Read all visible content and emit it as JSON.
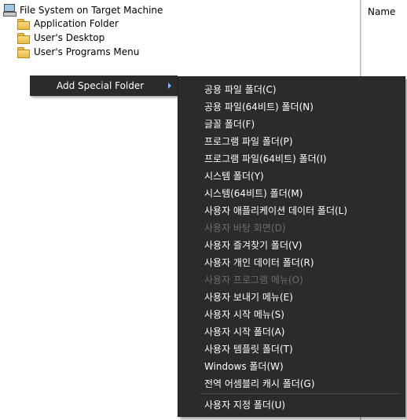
{
  "tree": {
    "root_label": "File System on Target Machine",
    "items": [
      {
        "label": "Application Folder"
      },
      {
        "label": "User's Desktop"
      },
      {
        "label": "User's Programs Menu"
      }
    ]
  },
  "list_header": {
    "name": "Name"
  },
  "submenu_parent": {
    "label": "Add Special Folder"
  },
  "menu": {
    "items": [
      {
        "label": "공용 파일 폴더(C)",
        "enabled": true
      },
      {
        "label": "공용 파일(64비트) 폴더(N)",
        "enabled": true
      },
      {
        "label": "글꼴 폴더(F)",
        "enabled": true
      },
      {
        "label": "프로그램 파일 폴더(P)",
        "enabled": true
      },
      {
        "label": "프로그램 파일(64비트) 폴더(I)",
        "enabled": true
      },
      {
        "label": "시스템 폴더(Y)",
        "enabled": true
      },
      {
        "label": "시스템(64비트) 폴더(M)",
        "enabled": true
      },
      {
        "label": "사용자 애플리케이션 데이터 폴더(L)",
        "enabled": true
      },
      {
        "label": "사용자 바탕 화면(D)",
        "enabled": false
      },
      {
        "label": "사용자 즐겨찾기 폴더(V)",
        "enabled": true
      },
      {
        "label": "사용자 개인 데이터 폴더(R)",
        "enabled": true
      },
      {
        "label": "사용자 프로그램 메뉴(O)",
        "enabled": false
      },
      {
        "label": "사용자 보내기 메뉴(E)",
        "enabled": true
      },
      {
        "label": "사용자 시작 메뉴(S)",
        "enabled": true
      },
      {
        "label": "사용자 시작 폴더(A)",
        "enabled": true
      },
      {
        "label": "사용자 템플릿 폴더(T)",
        "enabled": true
      },
      {
        "label": "Windows 폴더(W)",
        "enabled": true
      },
      {
        "label": "전역 어셈블리 캐시 폴더(G)",
        "enabled": true
      }
    ],
    "custom_item": {
      "label": "사용자 지정 폴더(U)",
      "enabled": true
    }
  }
}
